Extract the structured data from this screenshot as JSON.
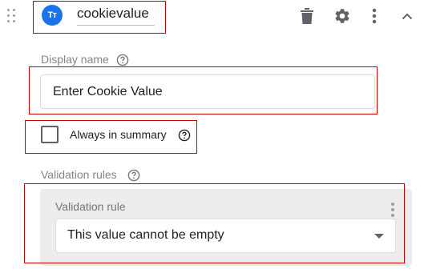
{
  "header": {
    "type_badge": "Tт",
    "variable_name": "cookievalue"
  },
  "display_name": {
    "label": "Display name",
    "value": "Enter Cookie Value"
  },
  "always_in_summary": {
    "label": "Always in summary",
    "checked": false
  },
  "validation": {
    "section_label": "Validation rules",
    "rule_label": "Validation rule",
    "selected_rule": "This value cannot be empty"
  },
  "colors": {
    "accent": "#1a73e8",
    "highlight_box": "#cc0000",
    "panel_bg": "#ededed"
  }
}
